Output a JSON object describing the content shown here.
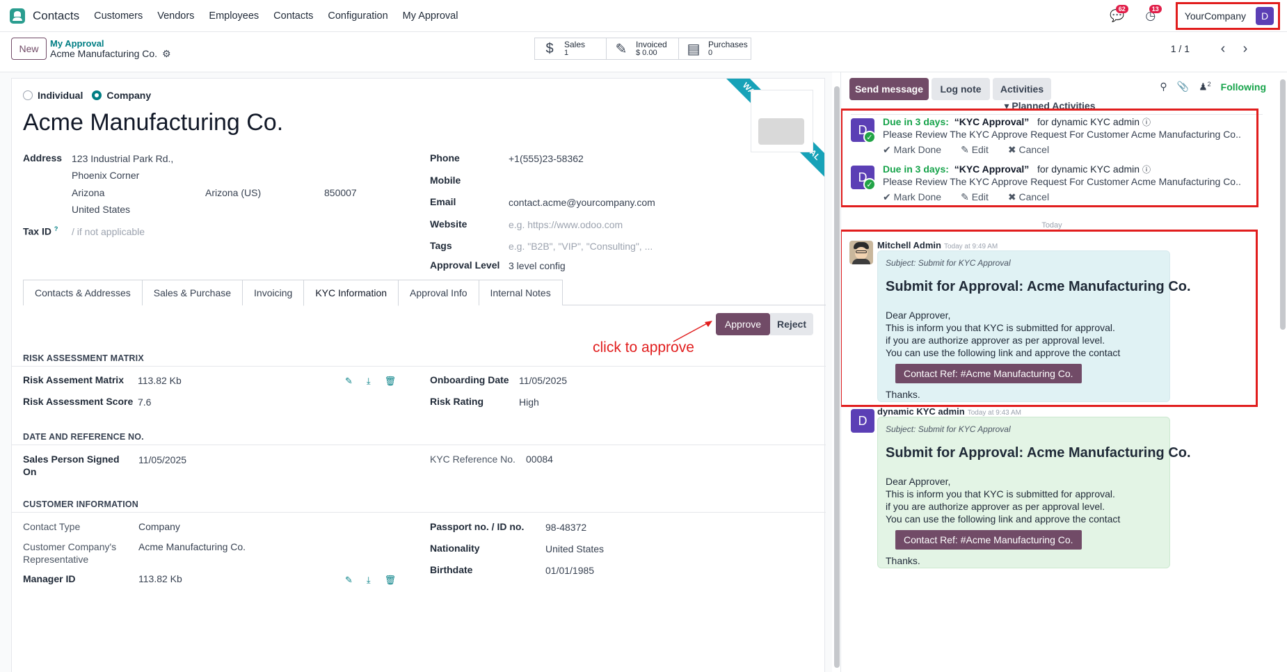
{
  "topbar": {
    "app_name": "Contacts",
    "menu": [
      "Customers",
      "Vendors",
      "Employees",
      "Contacts",
      "Configuration",
      "My Approval"
    ],
    "chat_badge": "62",
    "activity_badge": "13",
    "company": "YourCompany",
    "user_initial": "D"
  },
  "control": {
    "new_label": "New",
    "breadcrumb_parent": "My Approval",
    "breadcrumb_current": "Acme Manufacturing Co.",
    "smart_buttons": [
      {
        "label": "Sales",
        "value": "1",
        "icon": "dollar-icon"
      },
      {
        "label": "Invoiced",
        "value": "$ 0.00",
        "icon": "invoice-icon"
      },
      {
        "label": "Purchases",
        "value": "0",
        "icon": "card-icon"
      }
    ],
    "pager": "1 / 1"
  },
  "form": {
    "type_individual": "Individual",
    "type_company": "Company",
    "name": "Acme Manufacturing Co.",
    "ribbon": "WAITING FOR APPROVAL",
    "address_label": "Address",
    "street": "123 Industrial Park Rd.,",
    "street2": "Phoenix Corner",
    "city": "Arizona",
    "state": "Arizona (US)",
    "zip": "850007",
    "country": "United States",
    "tax_label": "Tax ID",
    "tax_placeholder": "/ if not applicable",
    "phone_label": "Phone",
    "phone": "+1(555)23-58362",
    "mobile_label": "Mobile",
    "email_label": "Email",
    "email": "contact.acme@yourcompany.com",
    "website_label": "Website",
    "website_placeholder": "e.g. https://www.odoo.com",
    "tags_label": "Tags",
    "tags_placeholder": "e.g. \"B2B\", \"VIP\", \"Consulting\", ...",
    "approval_level_label": "Approval Level",
    "approval_level": "3 level config",
    "tabs": [
      "Contacts & Addresses",
      "Sales & Purchase",
      "Invoicing",
      "KYC Information",
      "Approval Info",
      "Internal Notes"
    ],
    "approve_label": "Approve",
    "reject_label": "Reject",
    "annotation": "click to approve",
    "risk_section": "RISK ASSESSMENT MATRIX",
    "risk_matrix_label": "Risk Assement Matrix",
    "risk_matrix_size": "113.82 Kb",
    "risk_score_label": "Risk Assessment Score",
    "risk_score": "7.6",
    "onboarding_label": "Onboarding Date",
    "onboarding_date": "11/05/2025",
    "risk_rating_label": "Risk Rating",
    "risk_rating": "High",
    "date_section": "DATE AND REFERENCE NO.",
    "sales_signed_label_1": "Sales Person Signed",
    "sales_signed_label_2": "On",
    "sales_signed_date": "11/05/2025",
    "kyc_ref_label": "KYC Reference No.",
    "kyc_ref": "00084",
    "customer_section": "CUSTOMER INFORMATION",
    "contact_type_label": "Contact Type",
    "contact_type": "Company",
    "rep_label_1": "Customer Company's",
    "rep_label_2": "Representative",
    "rep_value": "Acme Manufacturing Co.",
    "manager_label": "Manager ID",
    "manager_size": "113.82 Kb",
    "passport_label": "Passport no. / ID no.",
    "passport": "98-48372",
    "nationality_label": "Nationality",
    "nationality": "United States",
    "birthdate_label": "Birthdate",
    "birthdate": "01/01/1985"
  },
  "chatter": {
    "send_message": "Send message",
    "log_note": "Log note",
    "activities": "Activities",
    "followers_count": "2",
    "following": "Following",
    "planned_title": "Planned Activities",
    "activity_items": [
      {
        "due": "Due in 3 days:",
        "title": "“KYC Approval”",
        "for": "for dynamic KYC admin",
        "desc": "Please Review The KYC Approve Request For Customer Acme Manufacturing Co..",
        "mark_done": "Mark Done",
        "edit": "Edit",
        "cancel": "Cancel",
        "initial": "D"
      },
      {
        "due": "Due in 3 days:",
        "title": "“KYC Approval”",
        "for": "for dynamic KYC admin",
        "desc": "Please Review The KYC Approve Request For Customer Acme Manufacturing Co..",
        "mark_done": "Mark Done",
        "edit": "Edit",
        "cancel": "Cancel",
        "initial": "D"
      }
    ],
    "today": "Today",
    "messages": [
      {
        "author": "Mitchell Admin",
        "time": "Today at 9:49 AM",
        "subject": "Subject: Submit for KYC Approval",
        "title": "Submit for Approval: Acme Manufacturing Co.",
        "lines": [
          "Dear Approver,",
          "This is inform you that KYC is submitted for approval.",
          "if you are authorize approver as per approval level.",
          "You can use the following link and approve the contact"
        ],
        "button": "Contact Ref: #Acme Manufacturing Co.",
        "thanks": "Thanks."
      },
      {
        "author": "dynamic KYC admin",
        "time": "Today at 9:43 AM",
        "subject": "Subject: Submit for KYC Approval",
        "title": "Submit for Approval: Acme Manufacturing Co.",
        "lines": [
          "Dear Approver,",
          "This is inform you that KYC is submitted for approval.",
          "if you are authorize approver as per approval level.",
          "You can use the following link and approve the contact"
        ],
        "button": "Contact Ref: #Acme Manufacturing Co.",
        "thanks": "Thanks.",
        "initial": "D"
      }
    ]
  }
}
